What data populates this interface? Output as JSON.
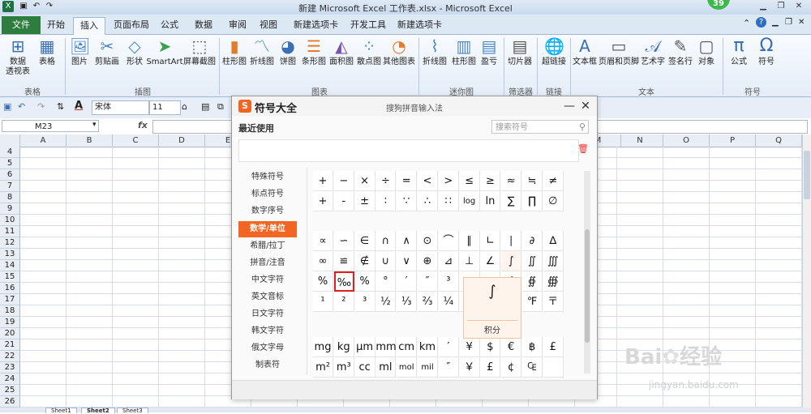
{
  "window": {
    "title": "新建 Microsoft Excel 工作表.xlsx - Microsoft Excel",
    "user_badge": "39"
  },
  "tabs": [
    "文件",
    "开始",
    "插入",
    "页面布局",
    "公式",
    "数据",
    "审阅",
    "视图",
    "新建选项卡",
    "开发工具",
    "新建选项卡"
  ],
  "ribbon": {
    "groups": [
      {
        "label": "表格",
        "buttons": [
          {
            "label": "数据\n透视表",
            "icon": "pivot-icon"
          },
          {
            "label": "表格",
            "icon": "table-icon"
          }
        ]
      },
      {
        "label": "插图",
        "buttons": [
          {
            "label": "图片",
            "icon": "picture-icon"
          },
          {
            "label": "剪贴画",
            "icon": "clipart-icon"
          },
          {
            "label": "形状",
            "icon": "shapes-icon"
          },
          {
            "label": "SmartArt",
            "icon": "smartart-icon"
          },
          {
            "label": "屏幕截图",
            "icon": "screenshot-icon"
          }
        ]
      },
      {
        "label": "图表",
        "buttons": [
          {
            "label": "柱形图",
            "icon": "column-chart-icon"
          },
          {
            "label": "折线图",
            "icon": "line-chart-icon"
          },
          {
            "label": "饼图",
            "icon": "pie-chart-icon"
          },
          {
            "label": "条形图",
            "icon": "bar-chart-icon"
          },
          {
            "label": "面积图",
            "icon": "area-chart-icon"
          },
          {
            "label": "散点图",
            "icon": "scatter-chart-icon"
          },
          {
            "label": "其他图表",
            "icon": "other-chart-icon"
          }
        ]
      },
      {
        "label": "迷你图",
        "buttons": [
          {
            "label": "折线图",
            "icon": "sparkline-line-icon"
          },
          {
            "label": "柱形图",
            "icon": "sparkline-column-icon"
          },
          {
            "label": "盈亏",
            "icon": "sparkline-winloss-icon"
          }
        ]
      },
      {
        "label": "筛选器",
        "buttons": [
          {
            "label": "切片器",
            "icon": "slicer-icon"
          }
        ]
      },
      {
        "label": "链接",
        "buttons": [
          {
            "label": "超链接",
            "icon": "hyperlink-icon"
          }
        ]
      },
      {
        "label": "文本",
        "buttons": [
          {
            "label": "文本框",
            "icon": "textbox-icon"
          },
          {
            "label": "页眉和页脚",
            "icon": "header-footer-icon"
          },
          {
            "label": "艺术字",
            "icon": "wordart-icon"
          },
          {
            "label": "签名行",
            "icon": "signature-icon"
          },
          {
            "label": "对象",
            "icon": "object-icon"
          }
        ]
      },
      {
        "label": "符号",
        "buttons": [
          {
            "label": "公式",
            "icon": "pi-icon"
          },
          {
            "label": "符号",
            "icon": "omega-icon"
          }
        ]
      }
    ]
  },
  "qat": {
    "font": "宋体",
    "size": "11"
  },
  "formula_bar": {
    "name_box": "M23",
    "fx": "fx"
  },
  "columns": [
    "A",
    "B",
    "C",
    "D",
    "E",
    "F",
    "G",
    "H",
    "I",
    "J",
    "K",
    "L",
    "M",
    "N",
    "O",
    "P",
    "Q"
  ],
  "rows": [
    "4",
    "5",
    "6",
    "7",
    "8",
    "9",
    "10",
    "11",
    "12",
    "13",
    "14",
    "15",
    "16",
    "17",
    "18",
    "19",
    "20",
    "21",
    "22",
    "23",
    "24",
    "25",
    "26"
  ],
  "sheet_tabs": [
    "Sheet1",
    "Sheet2",
    "Sheet3"
  ],
  "symbol_panel": {
    "title": "符号大全",
    "subtitle": "搜狗拼音输入法",
    "recent_label": "最近使用",
    "search_placeholder": "搜索符号",
    "categories": [
      "特殊符号",
      "标点符号",
      "数字序号",
      "数学/单位",
      "希腊/拉丁",
      "拼音/注音",
      "中文字符",
      "英文音标",
      "日文字符",
      "韩文字符",
      "俄文字母",
      "制表符"
    ],
    "active_category": "数学/单位",
    "grid_rows": [
      [
        "+",
        "−",
        "×",
        "÷",
        "=",
        "<",
        ">",
        "≤",
        "≥",
        "≈",
        "≒",
        "≠"
      ],
      [
        "+",
        "-",
        "±",
        "∶",
        "∵",
        "∴",
        "∷",
        "log",
        "ln",
        "∑",
        "∏",
        "∅"
      ],
      [
        "∝",
        "∽",
        "∈",
        "∩",
        "∧",
        "⊙",
        "⌒",
        "∥",
        "∟",
        "∣",
        "∂",
        "∆"
      ],
      [
        "∞",
        "≌",
        "∉",
        "∪",
        "∨",
        "⊕",
        "⊿",
        "⊥",
        "∠",
        "∫",
        "∬",
        "∭"
      ],
      [
        "%",
        "‰",
        "%",
        "°",
        "′",
        "″",
        "³",
        "",
        "",
        "∮",
        "∯",
        "∰"
      ],
      [
        "¹",
        "²",
        "³",
        "½",
        "⅓",
        "⅔",
        "¼",
        "",
        "",
        "℃",
        "℉",
        "〒"
      ],
      [
        "mg",
        "kg",
        "μm",
        "mm",
        "cm",
        "km",
        "′",
        "¥",
        "$",
        "€",
        "฿",
        "£"
      ],
      [
        "m²",
        "m³",
        "cc",
        "ml",
        "mol",
        "mil",
        "″",
        "￥",
        "£",
        "¢",
        "₠",
        ""
      ]
    ],
    "tooltip": {
      "symbol": "∫",
      "name": "积分"
    }
  },
  "watermark": {
    "brand": "Bai",
    "brand2": "经验",
    "url": "jingyan.baidu.com"
  }
}
